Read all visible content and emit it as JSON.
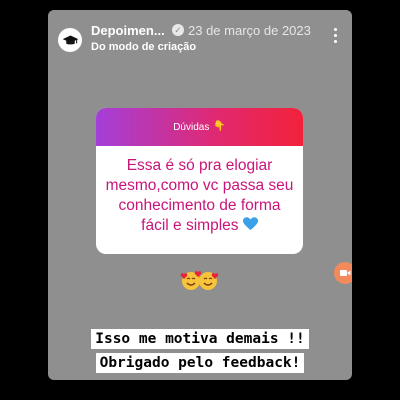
{
  "header": {
    "user_name": "Depoimen...",
    "date": "23 de março de 2023",
    "subtitle": "Do modo de criação"
  },
  "question_box": {
    "title": "Dúvidas",
    "title_emoji": "👇",
    "answer": "Essa é só pra elogiar mesmo,como vc passa seu conhecimento de forma fácil e simples"
  },
  "captions": {
    "line1": "Isso me motiva demais !!",
    "line2": "Obrigado pelo feedback!"
  },
  "colors": {
    "gradient_start": "#a43fd9",
    "gradient_end": "#f2223a",
    "answer_text": "#c8157a",
    "story_bg": "#8f8f8f"
  },
  "icons": {
    "avatar": "graduation-cap-icon",
    "verified": "verified-badge-icon",
    "more": "more-vertical-icon",
    "heart": "blue-heart-icon",
    "reaction": "smiling-hearts-emoji-icon",
    "side": "video-camera-icon"
  }
}
